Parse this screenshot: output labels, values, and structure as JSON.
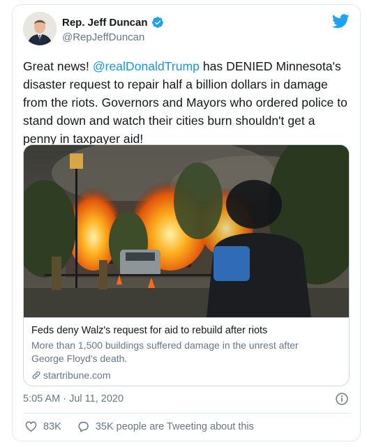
{
  "author": {
    "display_name": "Rep. Jeff Duncan",
    "handle": "@RepJeffDuncan",
    "verified": true
  },
  "tweet": {
    "text_before": "Great news! ",
    "mention": "@realDonaldTrump",
    "text_after": " has DENIED Minnesota's disaster request to repair half a billion dollars in damage from the riots. Governors and Mayors who ordered police to stand down and watch their cities burn shouldn't get a penny in taxpayer aid!"
  },
  "card": {
    "title": "Feds deny Walz's request for aid to rebuild after riots",
    "description": "More than 1,500 buildings suffered damage in the unrest after George Floyd's death.",
    "domain": "startribune.com"
  },
  "timestamp": "5:05 AM · Jul 11, 2020",
  "actions": {
    "likes": "83K",
    "conversation": "35K people are Tweeting about this"
  },
  "colors": {
    "twitter_blue": "#1da1f2",
    "mention": "#1b95e0",
    "secondary_text": "#657786"
  },
  "icons": {
    "logo": "twitter-bird-icon",
    "verified": "verified-badge-icon",
    "info": "info-icon",
    "like": "heart-icon",
    "conversation": "speech-bubble-icon",
    "link": "link-icon"
  }
}
